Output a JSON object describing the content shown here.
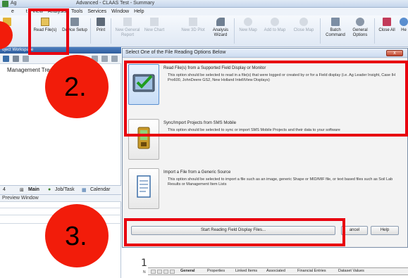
{
  "window": {
    "title": "Ag",
    "title_suffix": "Advanced - CLAAS Test - Summary"
  },
  "menu": [
    "e",
    "t",
    "View",
    "Analysis",
    "Tools",
    "Services",
    "Window",
    "Help"
  ],
  "ribbon": {
    "buttons": [
      {
        "label": "ject",
        "icon": "project-icon"
      },
      {
        "label": "Read File(s)",
        "icon": "read-files-icon"
      },
      {
        "label": "Device Setup",
        "icon": "device-setup-icon"
      },
      {
        "label": "Print",
        "icon": "print-icon"
      },
      {
        "label": "New General",
        "label2": "Report",
        "icon": "new-report-icon"
      },
      {
        "label": "New Chart",
        "icon": "new-chart-icon"
      },
      {
        "label": "New 3D Plot",
        "icon": "new-3d-plot-icon"
      },
      {
        "label": "Analysis",
        "label2": "Wizard",
        "icon": "analysis-wizard-icon"
      },
      {
        "label": "New Map",
        "icon": "new-map-icon"
      },
      {
        "label": "Add to Map",
        "icon": "add-to-map-icon"
      },
      {
        "label": "Close Map",
        "icon": "close-map-icon"
      },
      {
        "label": "Batch",
        "label2": "Command",
        "icon": "batch-command-icon"
      },
      {
        "label": "General",
        "label2": "Options",
        "icon": "general-options-icon"
      },
      {
        "label": "Close All",
        "icon": "close-all-icon"
      },
      {
        "label": "He",
        "icon": "help-icon"
      }
    ]
  },
  "workspace": {
    "header": "oject Workspace",
    "tree_title": "Management Tree",
    "tabs": [
      "4",
      "Main",
      "Job/Task",
      "Calendar"
    ],
    "preview_header": "Preview Window"
  },
  "dialog": {
    "title": "Select One of the File Reading Options Below",
    "close_label": "x",
    "options": [
      {
        "title": "Read File(s) from a Supported Field Display or Monitor",
        "desc": "This option should be selected to read in a file(s) that were logged or created by or for a Field display (i.e. Ag Leader Insight, Case IH Pro600, JohnDeere GS2, New Holland IntelliView Displays)"
      },
      {
        "title": "Sync/Import Projects from SMS Mobile",
        "desc": "This option should be selected to sync or import SMS Mobile Projects and their data to your software"
      },
      {
        "title": "Import a File from a Generic Source",
        "desc": "This option should be selected to import a file such as an image, generic Shape or MID/MIF file, or text based files such as Soil Lab Results or Management Item Lists"
      }
    ],
    "start_button": "Start Reading Field Display Files...",
    "cancel_button": "ancel",
    "help_button": "Help"
  },
  "document": {
    "row_number": "1",
    "row_letter": "N",
    "tabs": [
      "General",
      "Properties",
      "Linked Items",
      "Associated",
      "Financial Entries",
      "Dataset Values"
    ]
  },
  "annotations": {
    "step2": "2.",
    "step3": "3.",
    "accent_color": "#e8000f"
  }
}
